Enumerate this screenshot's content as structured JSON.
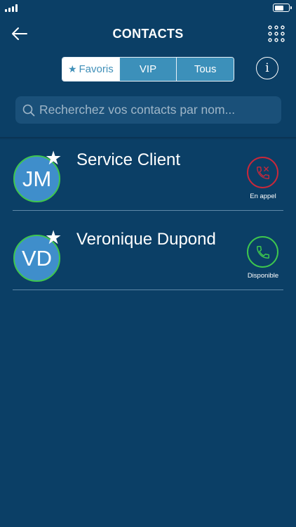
{
  "header": {
    "title": "CONTACTS"
  },
  "tabs": [
    {
      "label": "Favoris",
      "active": true
    },
    {
      "label": "VIP",
      "active": false
    },
    {
      "label": "Tous",
      "active": false
    }
  ],
  "info_button": {
    "label": "i"
  },
  "search": {
    "placeholder": "Recherchez vos contacts par nom...",
    "value": ""
  },
  "contacts": [
    {
      "initials": "JM",
      "name": "Service Client",
      "favorite": true,
      "status": "En appel",
      "status_color": "#c9283a"
    },
    {
      "initials": "VD",
      "name": "Veronique Dupond",
      "favorite": true,
      "status": "Disponible",
      "status_color": "#3ec64e"
    }
  ],
  "icons": {
    "back": "arrow-left-icon",
    "menu": "grid-dots-icon",
    "search": "magnifier-icon",
    "favorite": "star-icon",
    "busy_call": "phone-busy-icon",
    "call": "phone-icon"
  },
  "colors": {
    "background": "#0b3f66",
    "tab_inactive": "#3c90ba",
    "avatar": "#3f8ecb",
    "available": "#3ec64e",
    "busy": "#c9283a"
  }
}
